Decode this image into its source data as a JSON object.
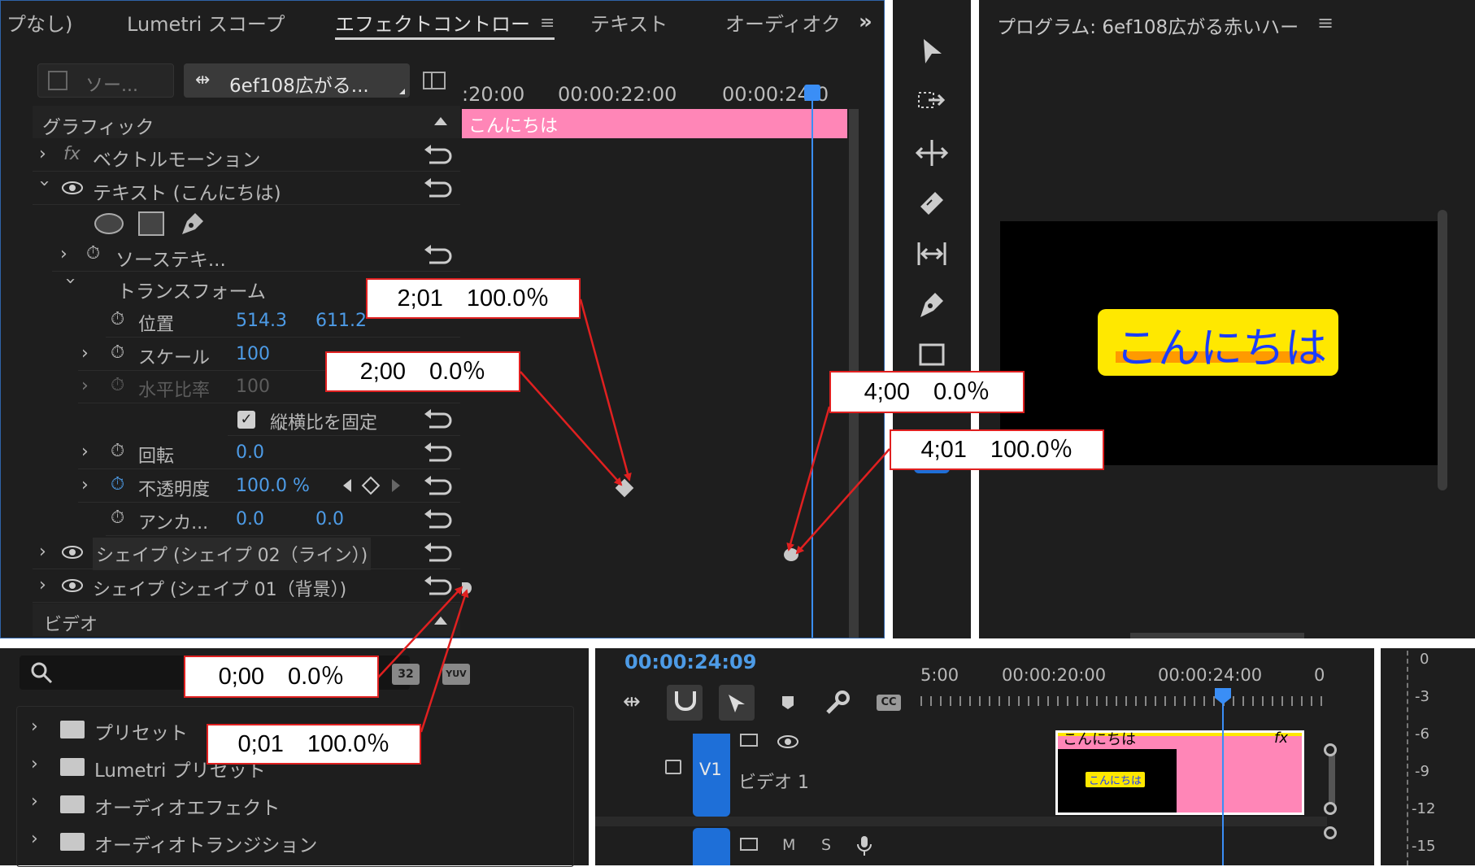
{
  "top_tabs": {
    "tab1": "プなし)",
    "tab2": "Lumetri スコープ",
    "tab3": "エフェクトコントロー",
    "tab4": "テキスト",
    "tab5": "オーディオク"
  },
  "effect_controls": {
    "source_tab": "ソー...",
    "clip_tab": "6ef108広がる...",
    "section_graphics": "グラフィック",
    "vector_motion": "ベクトルモーション",
    "text_layer": "テキスト (こんにちは)",
    "source_text": "ソーステキ...",
    "transform": "トランスフォーム",
    "position_label": "位置",
    "position_x": "514.3",
    "position_y": "611.2",
    "scale_label": "スケール",
    "scale_value": "100",
    "hscale_label": "水平比率",
    "hscale_value": "100",
    "uniform_scale_label": "縦横比を固定",
    "rotation_label": "回転",
    "rotation_value": "0.0",
    "opacity_label": "不透明度",
    "opacity_value": "100.0 %",
    "anchor_label": "アンカ...",
    "anchor_x": "0.0",
    "anchor_y": "0.0",
    "shape02": "シェイプ (シェイプ 02（ライン）)",
    "shape01": "シェイプ (シェイプ 01（背景）)",
    "section_video": "ビデオ"
  },
  "mini_timeline": {
    "tick1": ":20:00",
    "tick2": "00:00:22:00",
    "tick3": "00:00:24:0",
    "clip_label": "こんにちは"
  },
  "program_monitor": {
    "title": "プログラム: 6ef108広がる赤いハー",
    "preview_text": "こんにちは"
  },
  "callouts": {
    "c1": "2;01　100.0％",
    "c2": "2;00　0.0％",
    "c3": "4;00　0.0％",
    "c4": "4;01　100.0％",
    "c5": "0;00　0.0％",
    "c6": "0;01　100.0％"
  },
  "effects_panel": {
    "badge_32": "32",
    "badge_yuv": "YUV",
    "items": [
      "プリセット",
      "Lumetri プリセット",
      "オーディオエフェクト",
      "オーディオトランジション"
    ]
  },
  "timeline": {
    "timecode": "00:00:24:09",
    "tick1": "5:00",
    "tick2": "00:00:20:00",
    "tick3": "00:00:24:00",
    "tick4": "0",
    "v1_label": "V1",
    "track_name": "ビデオ 1",
    "clip_title": "こんにちは",
    "clip_thumb_text": "こんにちは",
    "fx_badge": "fx",
    "audio_m": "M",
    "audio_s": "S"
  },
  "meter": {
    "labels": [
      "0",
      "-3",
      "-6",
      "-9",
      "-12",
      "-15"
    ]
  },
  "colors": {
    "panel_bg": "#1e1e1e",
    "accent_blue": "#4d9be6",
    "playhead_blue": "#3a8ef6",
    "clip_pink": "#ff86b7",
    "callout_red": "#e02020",
    "preview_yellow": "#ffe800"
  }
}
